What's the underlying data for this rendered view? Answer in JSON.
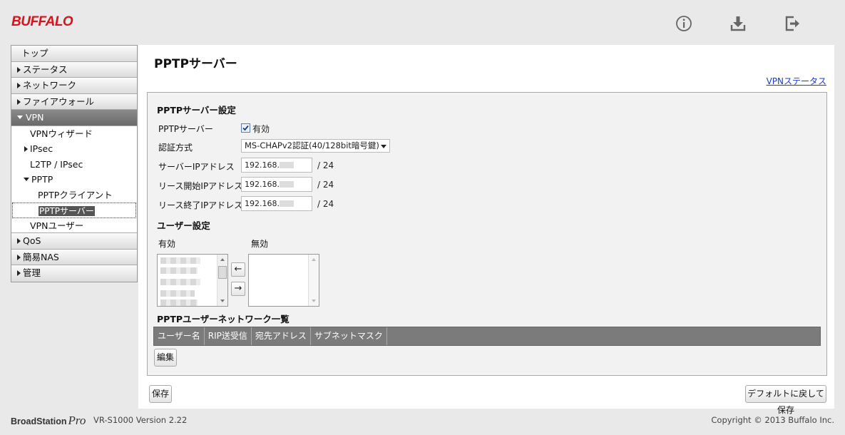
{
  "header": {
    "logo_text": "BUFFALO",
    "icons": [
      "info-icon",
      "download-icon",
      "logout-icon"
    ],
    "accent_color": "#d7131d"
  },
  "sidebar": {
    "items": [
      {
        "label": "トップ"
      },
      {
        "label": "ステータス"
      },
      {
        "label": "ネットワーク"
      },
      {
        "label": "ファイアウォール"
      },
      {
        "label": "VPN"
      },
      {
        "label": "QoS"
      },
      {
        "label": "簡易NAS"
      },
      {
        "label": "管理"
      }
    ],
    "vpn_sub": {
      "wizard": "VPNウィザード",
      "ipsec": "IPsec",
      "l2tp": "L2TP / IPsec",
      "pptp": "PPTP",
      "pptp_client": "PPTPクライアント",
      "pptp_server": "PPTPサーバー",
      "vpn_user": "VPNユーザー"
    }
  },
  "main": {
    "title": "PPTPサーバー",
    "status_link": "VPNステータス",
    "server_section": {
      "title": "PPTPサーバー設定",
      "server_label": "PPTPサーバー",
      "enabled_label": "有効",
      "auth_label": "認証方式",
      "auth_value": "MS-CHAPv2認証(40/128bit暗号鍵)",
      "server_ip_label": "サーバーIPアドレス",
      "server_ip_value": "192.168.",
      "lease_start_label": "リース開始IPアドレス",
      "lease_start_value": "192.168.",
      "lease_end_label": "リース終了IPアドレス",
      "lease_end_value": "192.168.",
      "mask": "/ 24"
    },
    "user_section": {
      "title": "ユーザー設定",
      "enabled_col": "有効",
      "disabled_col": "無効",
      "move_left": "←",
      "move_right": "→"
    },
    "network_section": {
      "title": "PPTPユーザーネットワーク一覧",
      "columns": [
        "ユーザー名",
        "RIP送受信",
        "宛先アドレス",
        "サブネットマスク"
      ],
      "edit_button": "編集"
    },
    "save_button": "保存",
    "default_save_button": "デフォルトに戻して保存"
  },
  "footer": {
    "brand": "BroadStation",
    "brand_pro": "Pro",
    "model": "VR-S1000 Version 2.22",
    "copyright": "Copyright © 2013 Buffalo Inc."
  }
}
